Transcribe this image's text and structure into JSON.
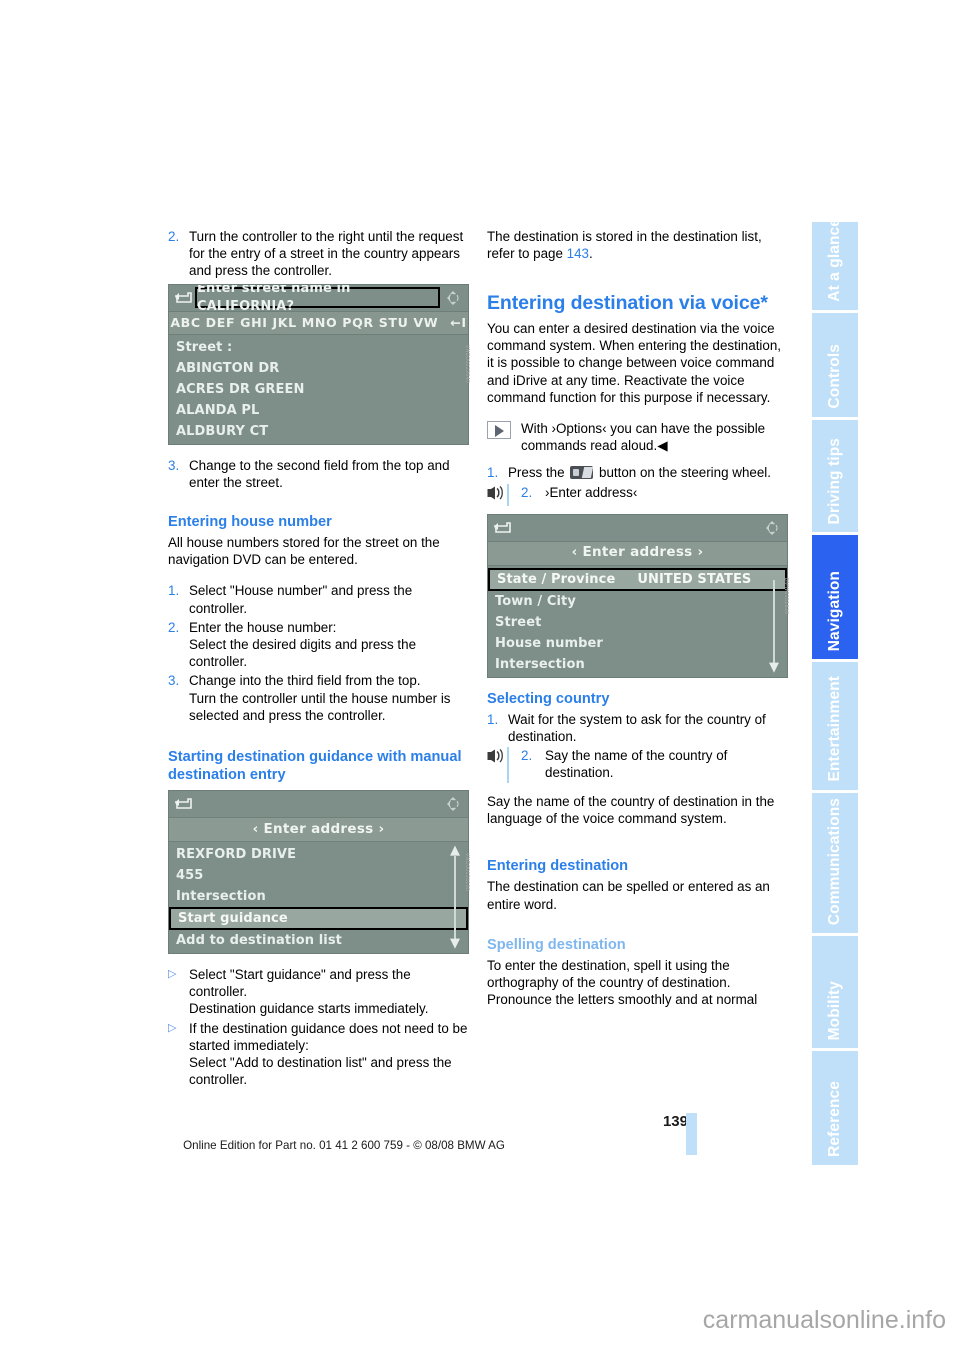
{
  "meta": {
    "page_number": "139",
    "footer_note": "Online Edition for Part no. 01 41 2 600 759 - © 08/08 BMW AG",
    "watermark": "carmanualsonline.info"
  },
  "tab_rail": {
    "tabs": [
      {
        "label": "At a glance",
        "active": false
      },
      {
        "label": "Controls",
        "active": false
      },
      {
        "label": "Driving tips",
        "active": false
      },
      {
        "label": "Navigation",
        "active": true
      },
      {
        "label": "Entertainment",
        "active": false
      },
      {
        "label": "Communications",
        "active": false
      },
      {
        "label": "Mobility",
        "active": false
      },
      {
        "label": "Reference",
        "active": false
      }
    ],
    "active_color": "#2b62ef",
    "inactive_color": "#bfe0f8"
  },
  "left_column": {
    "step2": {
      "num": "2.",
      "text": "Turn the controller to the right until the request for the entry of a street in the country appears and press the controller."
    },
    "screen_street": {
      "title": "Enter street name in CALIFORNIA?",
      "letters": "ABC DEF GHI JKL MNO PQR STU VW",
      "backspace": "←I",
      "rows": [
        "Street :",
        "ABINGTON DR",
        "ACRES DR GREEN",
        "ALANDA PL",
        "ALDBURY CT"
      ],
      "image_code": "VND00122040"
    },
    "step3": {
      "num": "3.",
      "text": "Change to the second field from the top and enter the street."
    },
    "heading_house_number": "Entering house number",
    "house_number_intro": "All house numbers stored for the street on the navigation DVD can be entered.",
    "house_steps": [
      {
        "num": "1.",
        "text": "Select \"House number\" and press the controller."
      },
      {
        "num": "2.",
        "text": "Enter the house number:\nSelect the desired digits and press the controller."
      },
      {
        "num": "3.",
        "text": "Change into the third field from the top.\nTurn the controller until the house number is selected and press the controller."
      }
    ],
    "heading_start_guidance": "Starting destination guidance with manual destination entry",
    "screen_guidance": {
      "title": "‹ Enter address ›",
      "rows": [
        {
          "label": "REXFORD DRIVE",
          "selected": false
        },
        {
          "label": "455",
          "selected": false
        },
        {
          "label": "Intersection",
          "selected": false
        },
        {
          "label": "Start guidance",
          "selected": true
        },
        {
          "label": "Add to destination list",
          "selected": false
        }
      ],
      "image_code": "VND00125190"
    },
    "bullets": [
      "Select \"Start guidance\" and press the controller.\nDestination guidance starts immediately.",
      "If the destination guidance does not need to be started immediately:\nSelect \"Add to destination list\" and press the controller."
    ]
  },
  "right_column": {
    "stored_note_prefix": "The destination is stored in the destination list, refer to page ",
    "stored_note_page": "143",
    "stored_note_suffix": ".",
    "heading_voice": "Entering destination via voice*",
    "voice_intro": "You can enter a desired destination via the voice command system. When entering the destination, it is possible to change between voice command and iDrive at any time. Reactivate the voice command function for this purpose if necessary.",
    "options_note": "With ›Options‹ you can have the possible commands read aloud.◀",
    "voice_steps": [
      {
        "num": "1.",
        "pre": "Press the ",
        "post": " button on the steering wheel.",
        "icon": "steering-wheel-button"
      },
      {
        "num": "2.",
        "text": "›Enter address‹",
        "icon": "voice-command-icon"
      }
    ],
    "screen_address": {
      "title": "‹ Enter address ›",
      "rows": [
        {
          "label": "State / Province",
          "value": "UNITED STATES",
          "selected": true
        },
        {
          "label": "Town / City",
          "value": "",
          "selected": false
        },
        {
          "label": "Street",
          "value": "",
          "selected": false
        },
        {
          "label": "House number",
          "value": "",
          "selected": false
        },
        {
          "label": "Intersection",
          "value": "",
          "selected": false
        }
      ],
      "image_code": "BMW0151818"
    },
    "heading_selecting_country": "Selecting country",
    "country_steps": [
      {
        "num": "1.",
        "text": "Wait for the system to ask for the country of destination."
      },
      {
        "num": "2.",
        "text": "Say the name of the country of destination.",
        "icon": "voice-command-icon"
      }
    ],
    "country_note": "Say the name of the country of destination in the language of the voice command system.",
    "heading_entering_destination": "Entering destination",
    "entering_destination_text": "The destination can be spelled or entered as an entire word.",
    "heading_spelling": "Spelling destination",
    "spelling_text": "To enter the destination, spell it using the orthography of the country of destination. Pronounce the letters smoothly and at normal"
  }
}
